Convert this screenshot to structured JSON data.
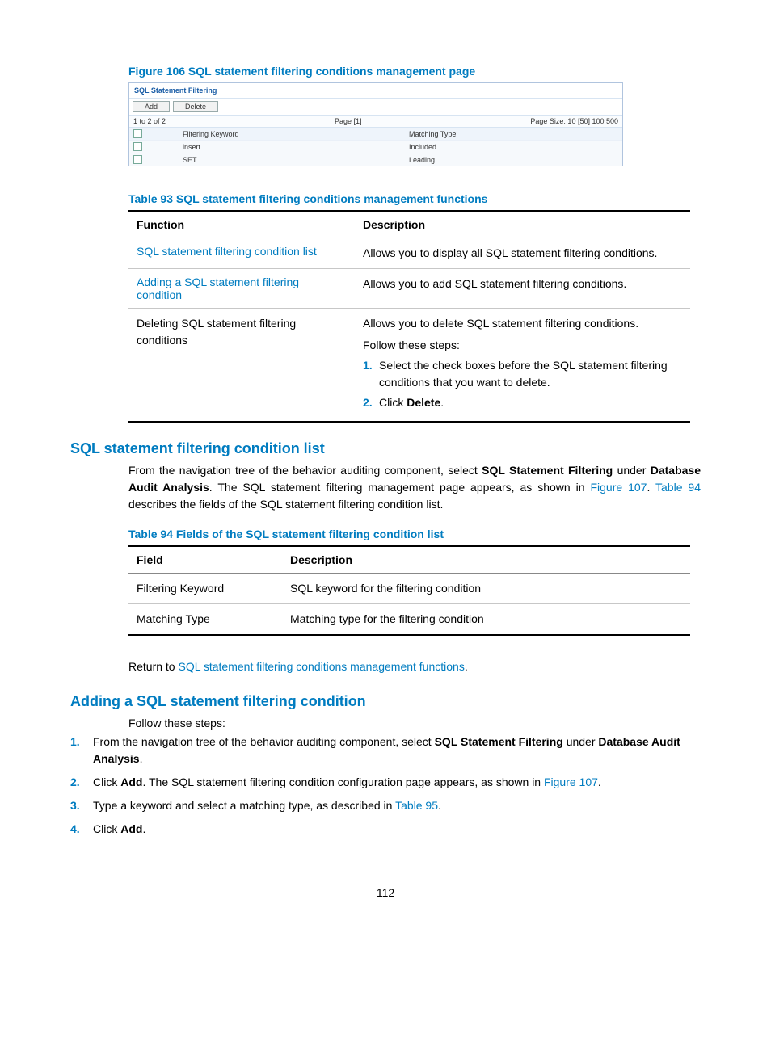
{
  "figure106": {
    "caption": "Figure 106 SQL statement filtering conditions management page",
    "panelTitle": "SQL Statement Filtering",
    "btnAdd": "Add",
    "btnDelete": "Delete",
    "pagerLeft": "1 to 2 of 2",
    "pagerCenter": "Page [1]",
    "pagerRight": "Page Size: 10 [50] 100 500",
    "headerCol1": "Filtering Keyword",
    "headerCol2": "Matching Type",
    "rows": [
      {
        "kw": "insert",
        "mt": "Included"
      },
      {
        "kw": "SET",
        "mt": "Leading"
      }
    ]
  },
  "table93": {
    "caption": "Table 93 SQL statement filtering conditions management functions",
    "head": {
      "c1": "Function",
      "c2": "Description"
    },
    "r1": {
      "fn": "SQL statement filtering condition list",
      "desc": "Allows you to display all SQL statement filtering conditions."
    },
    "r2": {
      "fn": "Adding a SQL statement filtering condition",
      "desc": "Allows you to add SQL statement filtering conditions."
    },
    "r3": {
      "fn": "Deleting SQL statement filtering conditions",
      "lead": "Allows you to delete SQL statement filtering conditions.",
      "follow": "Follow these steps:",
      "s1": "Select the check boxes before the SQL statement filtering conditions that you want to delete.",
      "s2a": "Click ",
      "s2b": "Delete",
      "s2c": "."
    }
  },
  "sec1": {
    "title": "SQL statement filtering condition list",
    "p_a": "From the navigation tree of the behavior auditing component, select ",
    "p_b": "SQL Statement Filtering",
    "p_c": " under ",
    "p_d": "Database Audit Analysis",
    "p_e": ". The SQL statement filtering management page appears, as shown in ",
    "link1": "Figure 107",
    "p_f": ". ",
    "link2": "Table 94",
    "p_g": " describes the fields of the SQL statement filtering condition list."
  },
  "table94": {
    "caption": "Table 94 Fields of the SQL statement filtering condition list",
    "head": {
      "c1": "Field",
      "c2": "Description"
    },
    "r1": {
      "f": "Filtering Keyword",
      "d": "SQL keyword for the filtering condition"
    },
    "r2": {
      "f": "Matching Type",
      "d": "Matching type for the filtering condition"
    }
  },
  "return": {
    "pre": "Return to ",
    "link": "SQL statement filtering conditions management functions",
    "post": "."
  },
  "sec2": {
    "title": "Adding a SQL statement filtering condition",
    "lead": "Follow these steps:",
    "s1a": "From the navigation tree of the behavior auditing component, select ",
    "s1b": "SQL Statement Filtering",
    "s1c": " under ",
    "s1d": "Database Audit Analysis",
    "s1e": ".",
    "s2a": "Click ",
    "s2b": "Add",
    "s2c": ". The SQL statement filtering condition configuration page appears, as shown in ",
    "s2link": "Figure 107",
    "s2d": ".",
    "s3a": "Type a keyword and select a matching type, as described in  ",
    "s3link": "Table 95",
    "s3b": ".",
    "s4a": "Click ",
    "s4b": "Add",
    "s4c": "."
  },
  "pageNumber": "112"
}
